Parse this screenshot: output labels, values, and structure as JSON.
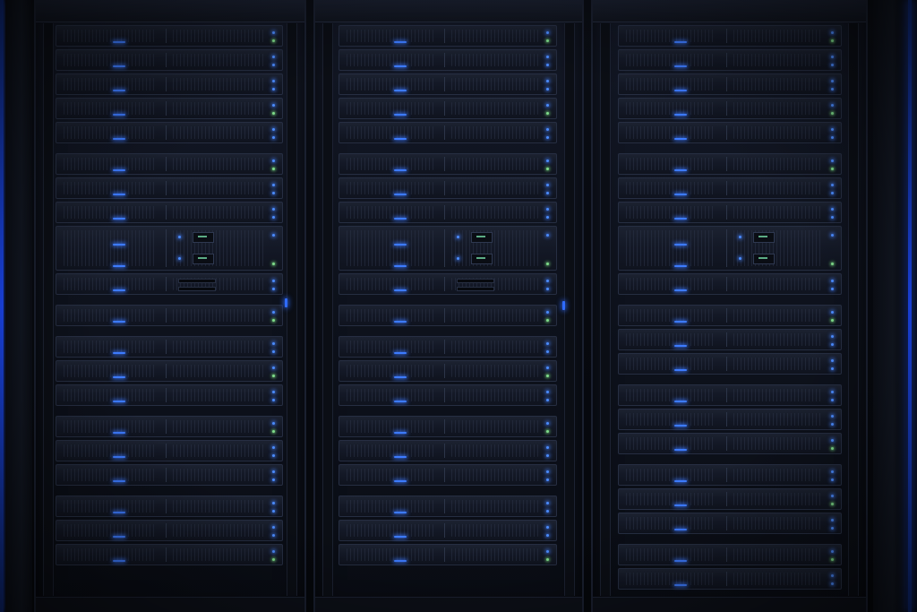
{
  "scene": {
    "subject": "server-racks",
    "colors": {
      "background": "#05070c",
      "cabinet": "#121725",
      "led_blue": "#4b8cff",
      "led_green": "#7fdc8a",
      "edge_glow": "#1d4bff"
    },
    "icons": [
      "server-icon",
      "status-led-icon"
    ]
  }
}
